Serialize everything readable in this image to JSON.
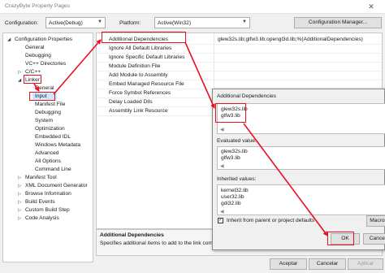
{
  "window": {
    "title": "CrazyByte Property Pages",
    "close_glyph": "✕"
  },
  "config": {
    "configuration_label": "Configuration:",
    "configuration_value": "Active(Debug)",
    "platform_label": "Platform:",
    "platform_value": "Active(Win32)",
    "manager_button": "Configuration Manager..."
  },
  "tree": {
    "items": [
      {
        "label": "Configuration Properties",
        "twisty": "◢"
      },
      {
        "label": "General"
      },
      {
        "label": "Debugging"
      },
      {
        "label": "VC++ Directories"
      },
      {
        "label": "C/C++",
        "twisty": "▷"
      },
      {
        "label": "Linker",
        "twisty": "◢"
      },
      {
        "label": "General"
      },
      {
        "label": "Input"
      },
      {
        "label": "Manifest File"
      },
      {
        "label": "Debugging"
      },
      {
        "label": "System"
      },
      {
        "label": "Optimization"
      },
      {
        "label": "Embedded IDL"
      },
      {
        "label": "Windows Metadata"
      },
      {
        "label": "Advanced"
      },
      {
        "label": "All Options"
      },
      {
        "label": "Command Line"
      },
      {
        "label": "Manifest Tool",
        "twisty": "▷"
      },
      {
        "label": "XML Document Generator",
        "twisty": "▷"
      },
      {
        "label": "Browse Information",
        "twisty": "▷"
      },
      {
        "label": "Build Events",
        "twisty": "▷"
      },
      {
        "label": "Custom Build Step",
        "twisty": "▷"
      },
      {
        "label": "Code Analysis",
        "twisty": "▷"
      }
    ]
  },
  "properties": {
    "rows": [
      {
        "name": "Additional Dependencies",
        "value": "glew32s.lib;glfw3.lib;opengl3d.lib;%(AdditionalDependencies)"
      },
      {
        "name": "Ignore All Default Libraries",
        "value": ""
      },
      {
        "name": "Ignore Specific Default Libraries",
        "value": ""
      },
      {
        "name": "Module Definition File",
        "value": ""
      },
      {
        "name": "Add Module to Assembly",
        "value": ""
      },
      {
        "name": "Embed Managed Resource File",
        "value": ""
      },
      {
        "name": "Force Symbol References",
        "value": ""
      },
      {
        "name": "Delay Loaded Dlls",
        "value": ""
      },
      {
        "name": "Assembly Link Resource",
        "value": ""
      }
    ]
  },
  "description": {
    "title": "Additional Dependencies",
    "text": "Specifies additional items to add to the link com"
  },
  "footer": {
    "accept": "Aceptar",
    "cancel": "Cancelar",
    "apply": "Aplicar"
  },
  "dialog": {
    "title": "Additional Dependencies",
    "edit_lines": [
      "glew32s.lib",
      "glfw3.lib"
    ],
    "evaluated_label": "Evaluated value:",
    "evaluated_lines": [
      "glew32s.lib",
      "glfw3.lib"
    ],
    "inherited_label": "Inherited values:",
    "inherited_lines": [
      "kernel32.lib",
      "user32.lib",
      "gdi32.lib"
    ],
    "inherit_checkbox": "Inherit from parent or project defaults",
    "inherit_checked": true,
    "macros_button": "Macros",
    "ok_button": "OK",
    "cancel_button": "Cancel"
  },
  "colors": {
    "highlight": "#e81123",
    "selection": "#cce8ff"
  }
}
